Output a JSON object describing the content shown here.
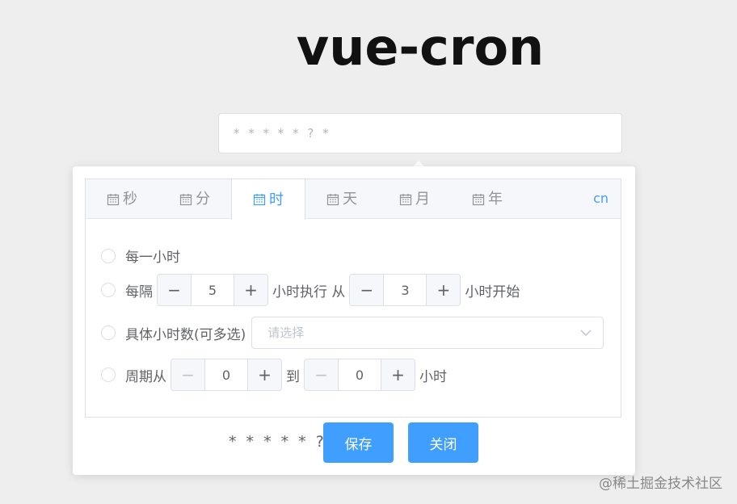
{
  "page": {
    "title": "vue-cron"
  },
  "input": {
    "value": "* * * * * ? *"
  },
  "tabs": [
    {
      "label": "秒",
      "icon": "calendar-icon"
    },
    {
      "label": "分",
      "icon": "calendar-icon"
    },
    {
      "label": "时",
      "icon": "calendar-icon",
      "active": true
    },
    {
      "label": "天",
      "icon": "calendar-icon"
    },
    {
      "label": "月",
      "icon": "calendar-icon"
    },
    {
      "label": "年",
      "icon": "calendar-icon"
    }
  ],
  "lang": "cn",
  "options": {
    "every": "每一小时",
    "interval": {
      "prefix": "每隔",
      "every_value": "5",
      "middle": "小时执行 从",
      "start_value": "3",
      "suffix": "小时开始"
    },
    "specific": {
      "label": "具体小时数(可多选)",
      "placeholder": "请选择"
    },
    "cycle": {
      "prefix": "周期从",
      "from_value": "0",
      "middle": "到",
      "to_value": "0",
      "suffix": "小时"
    }
  },
  "footer": {
    "expression": "* * * * * ? *",
    "save_label": "保存",
    "close_label": "关闭"
  },
  "watermark": "@稀土掘金技术社区",
  "colors": {
    "accent": "#409eff",
    "background": "#eeeeee"
  }
}
